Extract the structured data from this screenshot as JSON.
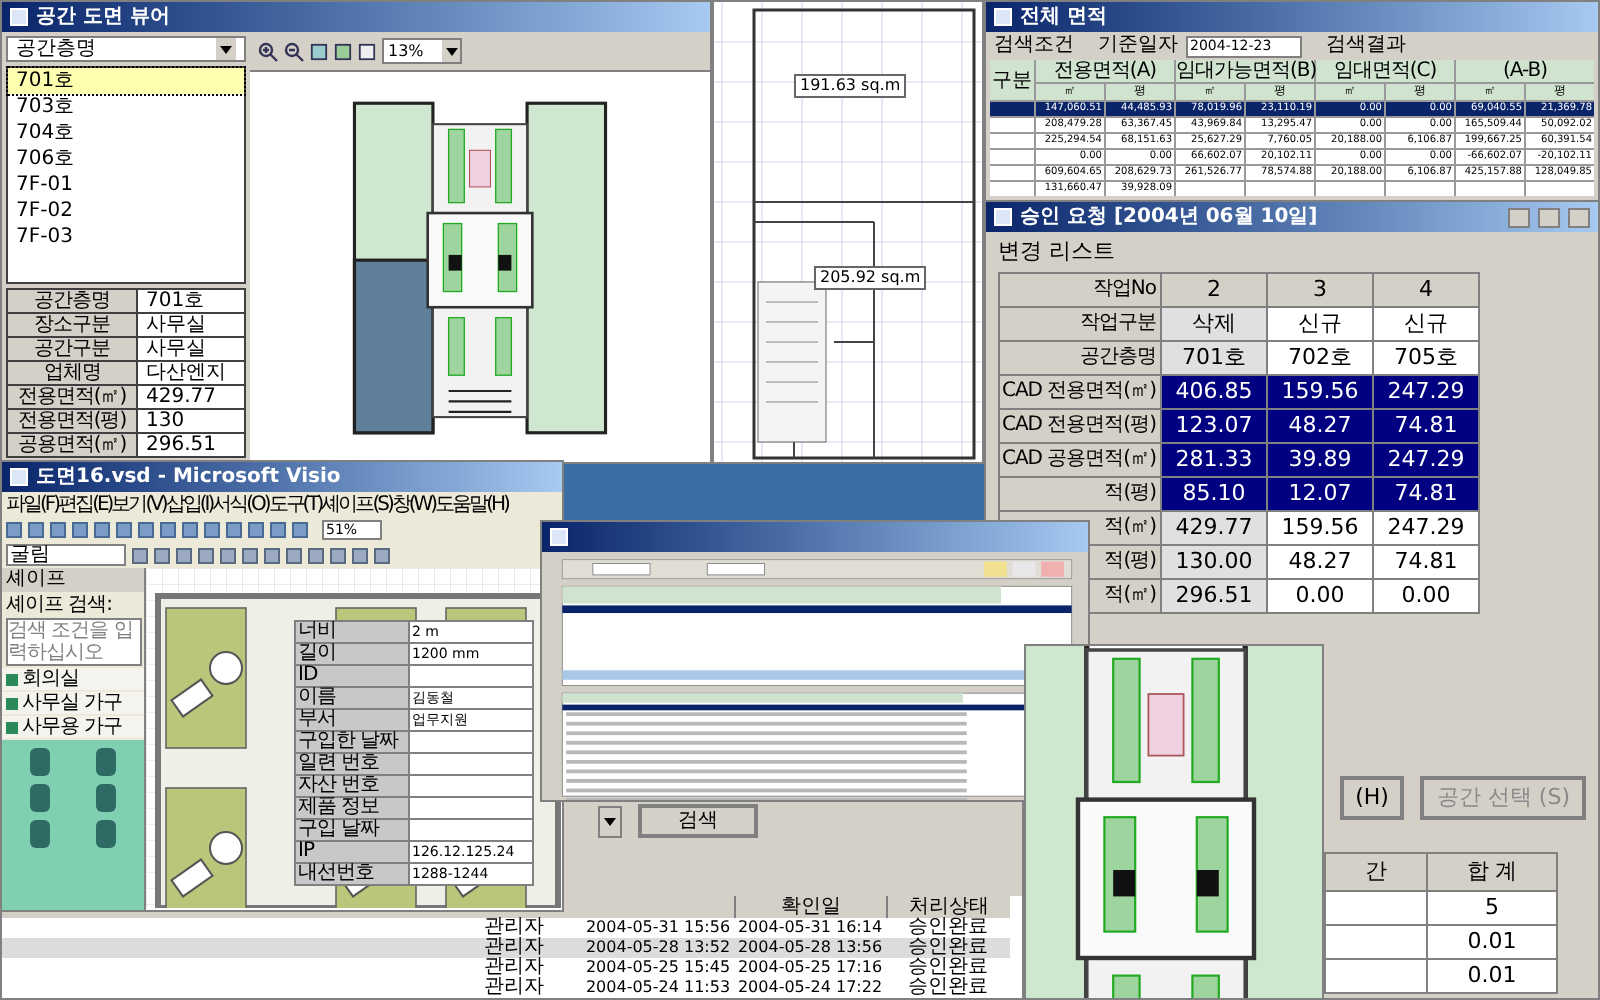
{
  "viewer": {
    "title": "공간 도면 뷰어",
    "floor_select": "공간층명",
    "rooms": [
      {
        "label": "701호",
        "selected": true
      },
      {
        "label": "703호",
        "selected": false
      },
      {
        "label": "704호",
        "selected": false
      },
      {
        "label": "706호",
        "selected": false
      },
      {
        "label": "7F-01",
        "selected": false
      },
      {
        "label": "7F-02",
        "selected": false
      },
      {
        "label": "7F-03",
        "selected": false
      }
    ],
    "zoom": "13%",
    "properties": [
      {
        "label": "공간층명",
        "value": "701호"
      },
      {
        "label": "장소구분",
        "value": "사무실"
      },
      {
        "label": "공간구분",
        "value": "사무실"
      },
      {
        "label": "업체명",
        "value": "다산엔지"
      },
      {
        "label": "전용면적(㎡)",
        "value": "429.77"
      },
      {
        "label": "전용면적(평)",
        "value": "130"
      },
      {
        "label": "공용면적(㎡)",
        "value": "296.51"
      }
    ]
  },
  "plan_window": {
    "area_labels": [
      "191.63 sq.m",
      "205.92 sq.m"
    ]
  },
  "area_window": {
    "title": "전체 면적",
    "condition_group": "검색조건",
    "date_label": "기준일자",
    "date": "2004-12-23",
    "result_group": "검색결과",
    "corner": "구분",
    "groups": [
      "전용면적(A)",
      "임대가능면적(B)",
      "임대면적(C)",
      "(A-B)"
    ],
    "units": [
      "㎡",
      "평",
      "㎡",
      "평",
      "㎡",
      "평",
      "㎡",
      "평"
    ],
    "rows": [
      {
        "cells": [
          "147,060.51",
          "44,485.93",
          "78,019.96",
          "23,110.19",
          "0.00",
          "0.00",
          "69,040.55",
          "21,369.78"
        ],
        "selected": true
      },
      {
        "cells": [
          "208,479.28",
          "63,367.45",
          "43,969.84",
          "13,295.47",
          "0.00",
          "0.00",
          "165,509.44",
          "50,092.02"
        ],
        "selected": false
      },
      {
        "cells": [
          "225,294.54",
          "68,151.63",
          "25,627.29",
          "7,760.05",
          "20,188.00",
          "6,106.87",
          "199,667.25",
          "60,391.54"
        ],
        "selected": false
      },
      {
        "cells": [
          "0.00",
          "0.00",
          "66,602.07",
          "20,102.11",
          "0.00",
          "0.00",
          "-66,602.07",
          "-20,102.11"
        ],
        "selected": false
      },
      {
        "cells": [
          "609,604.65",
          "208,629.73",
          "261,526.77",
          "78,574.88",
          "20,188.00",
          "6,106.87",
          "425,157.88",
          "128,049.85"
        ],
        "selected": false
      }
    ],
    "totals": [
      "131,660.47",
      "39,928.09"
    ]
  },
  "approval": {
    "title": "승인 요청 [2004년 06월 10일]",
    "list_title": "변경 리스트",
    "column_states": [
      {
        "shaded": true
      },
      {
        "shaded": false
      },
      {
        "shaded": false
      }
    ],
    "rows": [
      {
        "kind": "header",
        "label": "작업No",
        "values": [
          "2",
          "3",
          "4"
        ]
      },
      {
        "kind": "plain",
        "label": "작업구분",
        "values": [
          "삭제",
          "신규",
          "신규"
        ]
      },
      {
        "kind": "plain",
        "label": "공간층명",
        "values": [
          "701호",
          "702호",
          "705호"
        ]
      },
      {
        "kind": "highlight",
        "label": "CAD 전용면적(㎡)",
        "values": [
          "406.85",
          "159.56",
          "247.29"
        ]
      },
      {
        "kind": "highlight",
        "label": "CAD 전용면적(평)",
        "values": [
          "123.07",
          "48.27",
          "74.81"
        ]
      },
      {
        "kind": "highlight",
        "label": "CAD 공용면적(㎡)",
        "values": [
          "281.33",
          "39.89",
          "247.29"
        ]
      },
      {
        "kind": "highlight",
        "label": "적(평)",
        "values": [
          "85.10",
          "12.07",
          "74.81"
        ]
      },
      {
        "kind": "plain",
        "label": "적(㎡)",
        "values": [
          "429.77",
          "159.56",
          "247.29"
        ]
      },
      {
        "kind": "plain",
        "label": "적(평)",
        "values": [
          "130.00",
          "48.27",
          "74.81"
        ]
      },
      {
        "kind": "plain",
        "label": "적(㎡)",
        "values": [
          "296.51",
          "0.00",
          "0.00"
        ]
      }
    ],
    "buttons": [
      {
        "label": "(H)",
        "disabled": false
      },
      {
        "label": "공간 선택 (S)",
        "disabled": true
      }
    ],
    "summary_columns": [
      "간",
      "합 계"
    ],
    "summary_values": [
      "5",
      "0.01",
      "0.01"
    ]
  },
  "visio": {
    "title": "도면16.vsd - Microsoft Visio",
    "menus": [
      "파일(F)",
      "편집(E)",
      "보기(V)",
      "삽입(I)",
      "서식(O)",
      "도구(T)",
      "셰이프(S)",
      "창(W)",
      "도움말(H)"
    ],
    "font": "굴림",
    "zoom": "51%",
    "shapes_title": "셰이프",
    "search_label": "셰이프 검색:",
    "search_placeholder": "검색 조건을 입력하십시오",
    "stencils": [
      "회의실",
      "사무실 가구",
      "사무용 가구"
    ],
    "properties": [
      {
        "label": "너비",
        "value": "2 m"
      },
      {
        "label": "길이",
        "value": "1200 mm"
      },
      {
        "label": "ID"
      },
      {
        "label": "이름",
        "value": "김동철"
      },
      {
        "label": "부서",
        "value": "업무지원"
      },
      {
        "label": "구입한 날짜"
      },
      {
        "label": "일련 번호"
      },
      {
        "label": "자산 번호"
      },
      {
        "label": "제품 정보"
      },
      {
        "label": "구입 날짜"
      },
      {
        "label": "IP",
        "value": "126.12.125.24"
      },
      {
        "label": "내선번호",
        "value": "1288-1244"
      }
    ]
  },
  "history": {
    "search_button": "검색",
    "columns": [
      "확인일",
      "처리상태"
    ],
    "rows": [
      {
        "user": "관리자",
        "requested": "2004-05-31 15:56",
        "confirmed": "2004-05-31 16:14",
        "status": "승인완료",
        "selected": false
      },
      {
        "user": "관리자",
        "requested": "2004-05-28 13:52",
        "confirmed": "2004-05-28 13:56",
        "status": "승인완료",
        "selected": true
      },
      {
        "user": "관리자",
        "requested": "2004-05-25 15:45",
        "confirmed": "2004-05-25 17:16",
        "status": "승인완료",
        "selected": false
      },
      {
        "user": "관리자",
        "requested": "2004-05-24 11:53",
        "confirmed": "2004-05-24 17:22",
        "status": "승인완료",
        "selected": false
      }
    ]
  }
}
